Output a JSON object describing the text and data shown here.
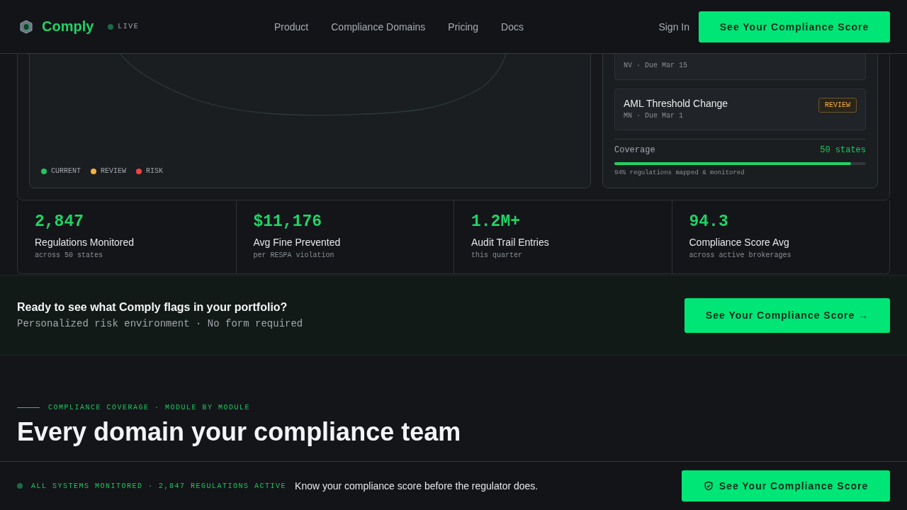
{
  "header": {
    "brand": "Comply",
    "status": "LIVE",
    "nav": [
      {
        "label": "Product"
      },
      {
        "label": "Compliance Domains"
      },
      {
        "label": "Pricing"
      },
      {
        "label": "Docs"
      }
    ],
    "sign_in": "Sign In",
    "cta": "See Your Compliance Score"
  },
  "hero": {
    "legend": [
      {
        "label": "CURRENT",
        "color": "#22c55e"
      },
      {
        "label": "REVIEW",
        "color": "#f5b041"
      },
      {
        "label": "RISK",
        "color": "#ef4444"
      }
    ],
    "alerts": [
      {
        "meta": "NV · Due Mar 15"
      },
      {
        "title": "AML Threshold Change",
        "meta": "MN · Due Mar 1",
        "badge": "REVIEW",
        "kind": "review"
      }
    ],
    "coverage": {
      "label": "Coverage",
      "value": "50 states",
      "level": 0.94,
      "note": "94% regulations mapped & monitored"
    }
  },
  "stats": [
    {
      "value": "2,847",
      "label": "Regulations Monitored",
      "sub": "across 50 states"
    },
    {
      "value": "$11,176",
      "label": "Avg Fine Prevented",
      "sub": "per RESPA violation"
    },
    {
      "value": "1.2M+",
      "label": "Audit Trail Entries",
      "sub": "this quarter"
    },
    {
      "value": "94.3",
      "label": "Compliance Score Avg",
      "sub": "across active brokerages"
    }
  ],
  "cta_band": {
    "title": "Ready to see what Comply flags in your portfolio?",
    "subtitle": "Personalized risk environment · No form required",
    "button": "See Your Compliance Score →"
  },
  "section": {
    "eyebrow": "COMPLIANCE COVERAGE · MODULE BY MODULE",
    "heading": "Every domain your compliance team"
  },
  "footer_bar": {
    "status": "ALL SYSTEMS MONITORED · 2,847 REGULATIONS ACTIVE",
    "message": "Know your compliance score before the regulator does.",
    "button": "See Your Compliance Score"
  }
}
